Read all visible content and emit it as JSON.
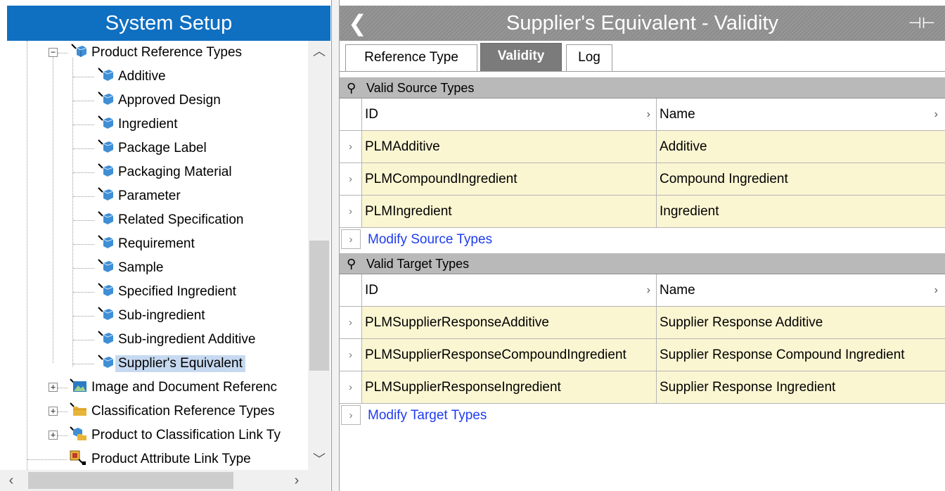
{
  "left_panel": {
    "title": "System Setup",
    "tree": {
      "parent": {
        "label": "Product Reference Types",
        "expanded": true
      },
      "children": [
        {
          "label": "Additive"
        },
        {
          "label": "Approved Design"
        },
        {
          "label": "Ingredient"
        },
        {
          "label": "Package Label"
        },
        {
          "label": "Packaging Material"
        },
        {
          "label": "Parameter"
        },
        {
          "label": "Related Specification"
        },
        {
          "label": "Requirement"
        },
        {
          "label": "Sample"
        },
        {
          "label": "Specified Ingredient"
        },
        {
          "label": "Sub-ingredient"
        },
        {
          "label": "Sub-ingredient Additive"
        },
        {
          "label": "Supplier's Equivalent",
          "selected": true
        }
      ],
      "siblings": [
        {
          "label": "Image and Document Referenc",
          "icon": "image-icon"
        },
        {
          "label": "Classification Reference Types",
          "icon": "folder-icon"
        },
        {
          "label": "Product to Classification Link Ty",
          "icon": "link-type-icon"
        },
        {
          "label": "Product Attribute Link Type",
          "icon": "attribute-link-icon"
        }
      ]
    }
  },
  "right_panel": {
    "title": "Supplier's Equivalent - Validity",
    "tabs": [
      {
        "label": "Reference Type",
        "active": false
      },
      {
        "label": "Validity",
        "active": true
      },
      {
        "label": "Log",
        "active": false
      }
    ],
    "source": {
      "header": "Valid Source Types",
      "col_id": "ID",
      "col_name": "Name",
      "rows": [
        {
          "id": "PLMAdditive",
          "name": "Additive"
        },
        {
          "id": "PLMCompoundIngredient",
          "name": "Compound Ingredient"
        },
        {
          "id": "PLMIngredient",
          "name": "Ingredient"
        }
      ],
      "modify_link": "Modify Source Types"
    },
    "target": {
      "header": "Valid Target Types",
      "col_id": "ID",
      "col_name": "Name",
      "rows": [
        {
          "id": "PLMSupplierResponseAdditive",
          "name": "Supplier Response Additive"
        },
        {
          "id": "PLMSupplierResponseCompoundIngredient",
          "name": "Supplier Response Compound Ingredient"
        },
        {
          "id": "PLMSupplierResponseIngredient",
          "name": "Supplier Response Ingredient"
        }
      ],
      "modify_link": "Modify Target Types"
    }
  },
  "colors": {
    "title_blue": "#0f6fc1",
    "row_yellow": "#fbf6d2",
    "link_blue": "#1f3cf0",
    "selection": "#c6d9f0"
  }
}
